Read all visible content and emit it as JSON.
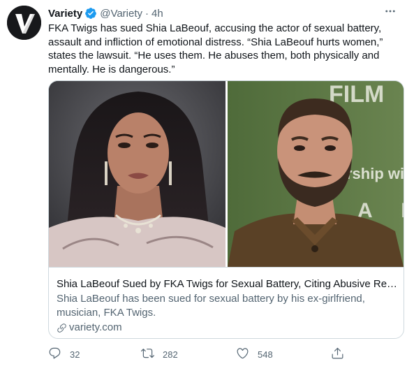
{
  "tweet": {
    "author_name": "Variety",
    "handle": "@Variety",
    "separator": "·",
    "time": "4h",
    "text": "FKA Twigs has sued Shia LaBeouf, accusing the actor of sexual battery, assault and infliction of emotional distress. “Shia LaBeouf hurts women,” states the lawsuit. “He uses them. He abuses them, both physically and mentally. He is dangerous.”"
  },
  "card": {
    "title": "Shia LaBeouf Sued by FKA Twigs for Sexual Battery, Citing Abusive Relat...",
    "description": "Shia LaBeouf has been sued for sexual battery by his ex-girlfriend, musician, FKA Twigs.",
    "domain": "variety.com",
    "backdrop_text_top": "FILM",
    "backdrop_text_mid": "rship wit",
    "backdrop_text_bottom": "A     FAN"
  },
  "actions": {
    "replies": "32",
    "retweets": "282",
    "likes": "548"
  },
  "colors": {
    "text": "#0f1419",
    "secondary": "#536471",
    "verified": "#1d9bf0",
    "border": "#cfd9de"
  },
  "icons": [
    "verified-badge-icon",
    "more-icon",
    "link-icon",
    "reply-icon",
    "retweet-icon",
    "like-icon",
    "share-icon"
  ]
}
